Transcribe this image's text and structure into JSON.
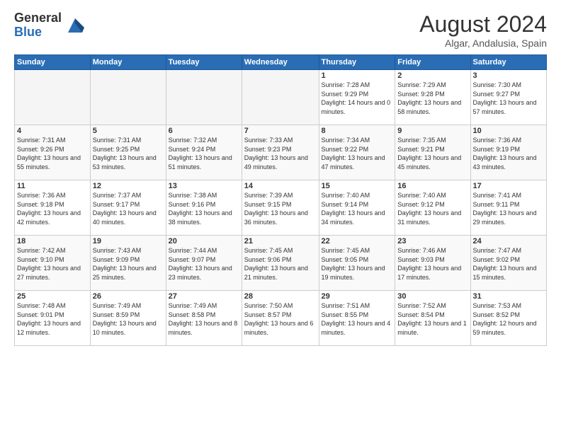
{
  "header": {
    "logo_general": "General",
    "logo_blue": "Blue",
    "month_title": "August 2024",
    "location": "Algar, Andalusia, Spain"
  },
  "weekdays": [
    "Sunday",
    "Monday",
    "Tuesday",
    "Wednesday",
    "Thursday",
    "Friday",
    "Saturday"
  ],
  "weeks": [
    [
      {
        "day": "",
        "empty": true
      },
      {
        "day": "",
        "empty": true
      },
      {
        "day": "",
        "empty": true
      },
      {
        "day": "",
        "empty": true
      },
      {
        "day": "1",
        "sunrise": "7:28 AM",
        "sunset": "9:29 PM",
        "daylight": "14 hours and 0 minutes."
      },
      {
        "day": "2",
        "sunrise": "7:29 AM",
        "sunset": "9:28 PM",
        "daylight": "13 hours and 58 minutes."
      },
      {
        "day": "3",
        "sunrise": "7:30 AM",
        "sunset": "9:27 PM",
        "daylight": "13 hours and 57 minutes."
      }
    ],
    [
      {
        "day": "4",
        "sunrise": "7:31 AM",
        "sunset": "9:26 PM",
        "daylight": "13 hours and 55 minutes."
      },
      {
        "day": "5",
        "sunrise": "7:31 AM",
        "sunset": "9:25 PM",
        "daylight": "13 hours and 53 minutes."
      },
      {
        "day": "6",
        "sunrise": "7:32 AM",
        "sunset": "9:24 PM",
        "daylight": "13 hours and 51 minutes."
      },
      {
        "day": "7",
        "sunrise": "7:33 AM",
        "sunset": "9:23 PM",
        "daylight": "13 hours and 49 minutes."
      },
      {
        "day": "8",
        "sunrise": "7:34 AM",
        "sunset": "9:22 PM",
        "daylight": "13 hours and 47 minutes."
      },
      {
        "day": "9",
        "sunrise": "7:35 AM",
        "sunset": "9:21 PM",
        "daylight": "13 hours and 45 minutes."
      },
      {
        "day": "10",
        "sunrise": "7:36 AM",
        "sunset": "9:19 PM",
        "daylight": "13 hours and 43 minutes."
      }
    ],
    [
      {
        "day": "11",
        "sunrise": "7:36 AM",
        "sunset": "9:18 PM",
        "daylight": "13 hours and 42 minutes."
      },
      {
        "day": "12",
        "sunrise": "7:37 AM",
        "sunset": "9:17 PM",
        "daylight": "13 hours and 40 minutes."
      },
      {
        "day": "13",
        "sunrise": "7:38 AM",
        "sunset": "9:16 PM",
        "daylight": "13 hours and 38 minutes."
      },
      {
        "day": "14",
        "sunrise": "7:39 AM",
        "sunset": "9:15 PM",
        "daylight": "13 hours and 36 minutes."
      },
      {
        "day": "15",
        "sunrise": "7:40 AM",
        "sunset": "9:14 PM",
        "daylight": "13 hours and 34 minutes."
      },
      {
        "day": "16",
        "sunrise": "7:40 AM",
        "sunset": "9:12 PM",
        "daylight": "13 hours and 31 minutes."
      },
      {
        "day": "17",
        "sunrise": "7:41 AM",
        "sunset": "9:11 PM",
        "daylight": "13 hours and 29 minutes."
      }
    ],
    [
      {
        "day": "18",
        "sunrise": "7:42 AM",
        "sunset": "9:10 PM",
        "daylight": "13 hours and 27 minutes."
      },
      {
        "day": "19",
        "sunrise": "7:43 AM",
        "sunset": "9:09 PM",
        "daylight": "13 hours and 25 minutes."
      },
      {
        "day": "20",
        "sunrise": "7:44 AM",
        "sunset": "9:07 PM",
        "daylight": "13 hours and 23 minutes."
      },
      {
        "day": "21",
        "sunrise": "7:45 AM",
        "sunset": "9:06 PM",
        "daylight": "13 hours and 21 minutes."
      },
      {
        "day": "22",
        "sunrise": "7:45 AM",
        "sunset": "9:05 PM",
        "daylight": "13 hours and 19 minutes."
      },
      {
        "day": "23",
        "sunrise": "7:46 AM",
        "sunset": "9:03 PM",
        "daylight": "13 hours and 17 minutes."
      },
      {
        "day": "24",
        "sunrise": "7:47 AM",
        "sunset": "9:02 PM",
        "daylight": "13 hours and 15 minutes."
      }
    ],
    [
      {
        "day": "25",
        "sunrise": "7:48 AM",
        "sunset": "9:01 PM",
        "daylight": "13 hours and 12 minutes."
      },
      {
        "day": "26",
        "sunrise": "7:49 AM",
        "sunset": "8:59 PM",
        "daylight": "13 hours and 10 minutes."
      },
      {
        "day": "27",
        "sunrise": "7:49 AM",
        "sunset": "8:58 PM",
        "daylight": "13 hours and 8 minutes."
      },
      {
        "day": "28",
        "sunrise": "7:50 AM",
        "sunset": "8:57 PM",
        "daylight": "13 hours and 6 minutes."
      },
      {
        "day": "29",
        "sunrise": "7:51 AM",
        "sunset": "8:55 PM",
        "daylight": "13 hours and 4 minutes."
      },
      {
        "day": "30",
        "sunrise": "7:52 AM",
        "sunset": "8:54 PM",
        "daylight": "13 hours and 1 minute."
      },
      {
        "day": "31",
        "sunrise": "7:53 AM",
        "sunset": "8:52 PM",
        "daylight": "12 hours and 59 minutes."
      }
    ]
  ]
}
